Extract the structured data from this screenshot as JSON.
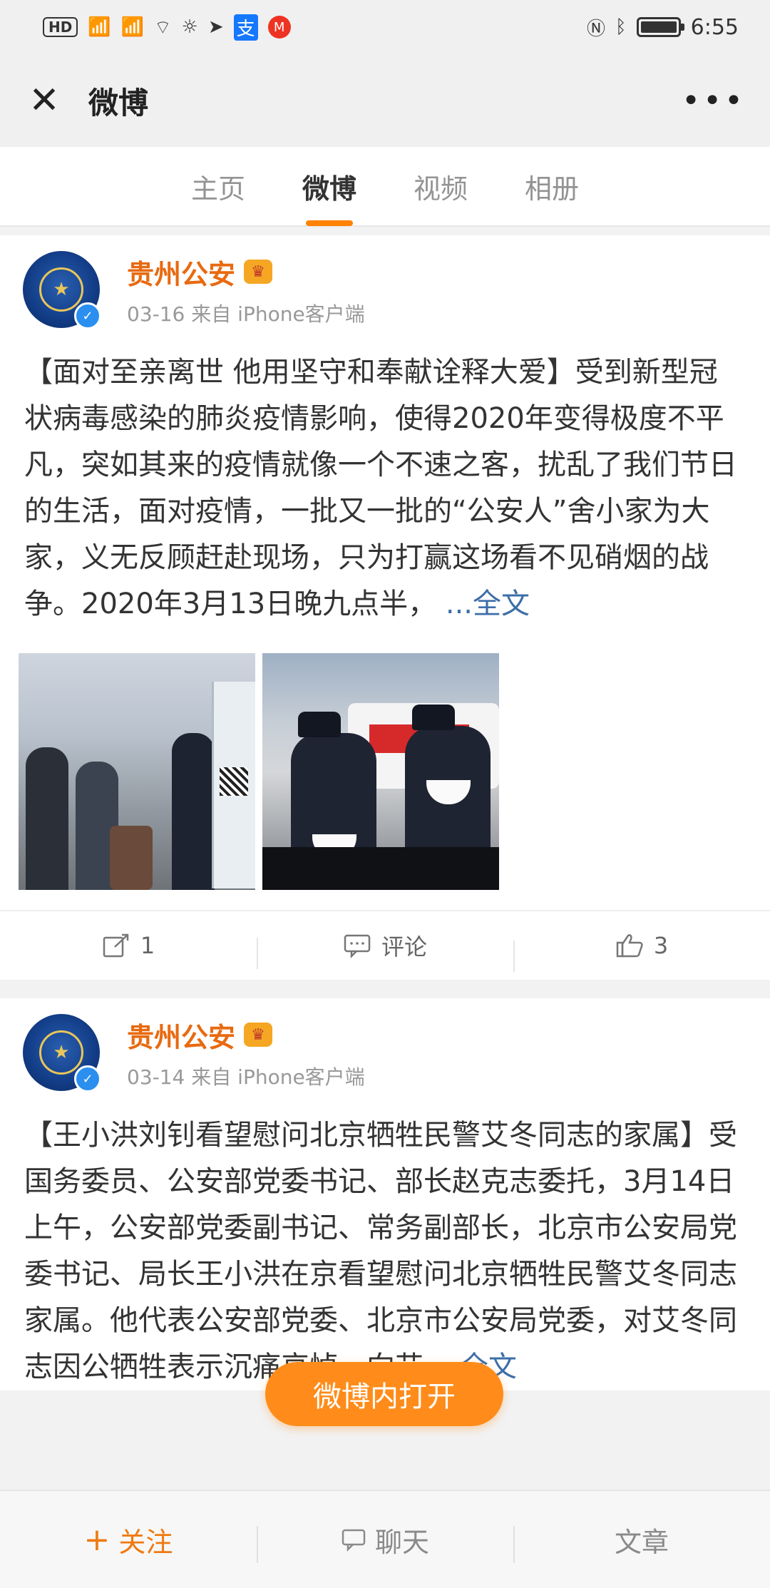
{
  "status_bar": {
    "left_icons": [
      "HD",
      "4G",
      "2G",
      "wifi",
      "brightness",
      "compass",
      "支",
      "M"
    ],
    "time": "6:55",
    "right_icons": [
      "nfc-icon",
      "bluetooth-icon",
      "battery-icon"
    ]
  },
  "titlebar": {
    "title": "微博"
  },
  "tabs": [
    {
      "label": "主页",
      "active": false
    },
    {
      "label": "微博",
      "active": true
    },
    {
      "label": "视频",
      "active": false
    },
    {
      "label": "相册",
      "active": false
    }
  ],
  "posts": [
    {
      "username": "贵州公安",
      "timestamp": "03-16 来自 iPhone客户端",
      "text": "【面对至亲离世 他用坚守和奉献诠释大爱】受到新型冠状病毒感染的肺炎疫情影响，使得2020年变得极度不平凡，突如其来的疫情就像一个不速之客，扰乱了我们节日的生活，面对疫情，一批又一批的“公安人”舍小家为大家，义无反顾赶赴现场，只为打赢这场看不见硝烟的战争。2020年3月13日晚九点半，",
      "more": "...全文",
      "repost_count": "1",
      "comment_label": "评论",
      "like_count": "3"
    },
    {
      "username": "贵州公安",
      "timestamp": "03-14 来自 iPhone客户端",
      "text": "【王小洪刘钊看望慰问北京牺牲民警艾冬同志的家属】受国务委员、公安部党委书记、部长赵克志委托，3月14日上午，公安部党委副书记、常务副部长，北京市公安局党委书记、局长王小洪在京看望慰问北京牺牲民警艾冬同志家属。他代表公安部党委、北京市公安局党委，对艾冬同志因公牺牲表示沉痛哀悼，向艾",
      "more": "...全文"
    }
  ],
  "open_button": "微博内打开",
  "bottom_bar": {
    "follow": "关注",
    "chat": "聊天",
    "articles": "文章"
  },
  "colors": {
    "accent": "#ff8200",
    "username": "#e86a10",
    "link": "#3d6ea8"
  }
}
